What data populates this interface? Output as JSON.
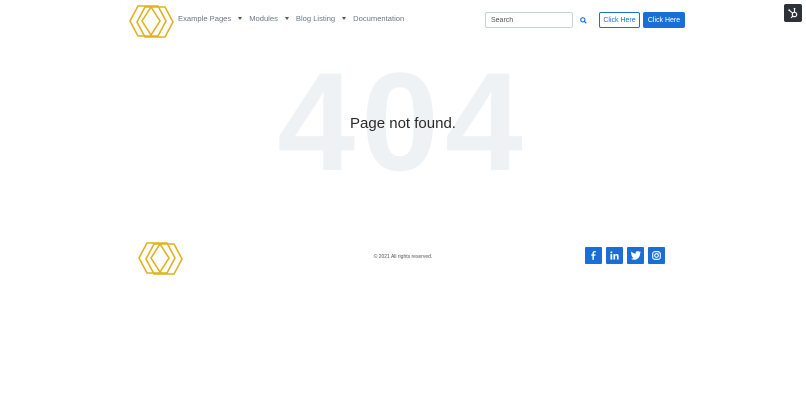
{
  "nav": {
    "items": [
      {
        "label": "Example Pages",
        "has_dropdown": true
      },
      {
        "label": "Modules",
        "has_dropdown": true
      },
      {
        "label": "Blog Listing",
        "has_dropdown": true
      },
      {
        "label": "Documentation",
        "has_dropdown": false
      }
    ]
  },
  "search": {
    "placeholder": "Search"
  },
  "buttons": {
    "outline_label": "Click Here",
    "solid_label": "Click Here"
  },
  "hero": {
    "code": "404",
    "message": "Page not found."
  },
  "footer": {
    "copyright": "© 2021 All rights reserved.",
    "social": [
      "facebook-icon",
      "linkedin-icon",
      "twitter-icon",
      "instagram-icon"
    ]
  },
  "colors": {
    "accent": "#1a6fd6",
    "logo": "#e0b21f",
    "bg_text": "#eff2f5"
  },
  "icons": {
    "hubspot": "hubspot-icon",
    "search": "search-icon",
    "logo": "hexagon-logo"
  }
}
